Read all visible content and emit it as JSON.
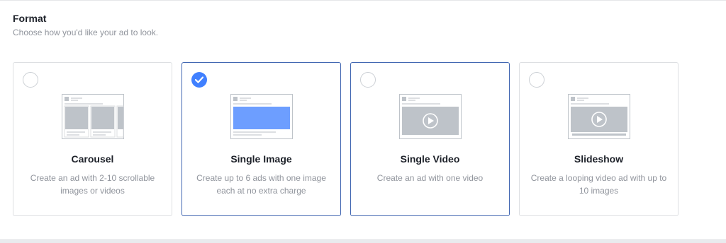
{
  "header": {
    "title": "Format",
    "subtitle": "Choose how you'd like your ad to look."
  },
  "colors": {
    "accent": "#4080ff",
    "selected_border": "#4267b2",
    "muted_text": "#90949c"
  },
  "formats": [
    {
      "id": "carousel",
      "title": "Carousel",
      "description": "Create an ad with 2-10 scrollable images or videos",
      "selected": false,
      "icon": "carousel-preview-icon"
    },
    {
      "id": "single-image",
      "title": "Single Image",
      "description": "Create up to 6 ads with one image each at no extra charge",
      "selected": true,
      "icon": "single-image-preview-icon"
    },
    {
      "id": "single-video",
      "title": "Single Video",
      "description": "Create an ad with one video",
      "selected": false,
      "icon": "single-video-preview-icon"
    },
    {
      "id": "slideshow",
      "title": "Slideshow",
      "description": "Create a looping video ad with up to 10 images",
      "selected": false,
      "icon": "slideshow-preview-icon"
    }
  ]
}
